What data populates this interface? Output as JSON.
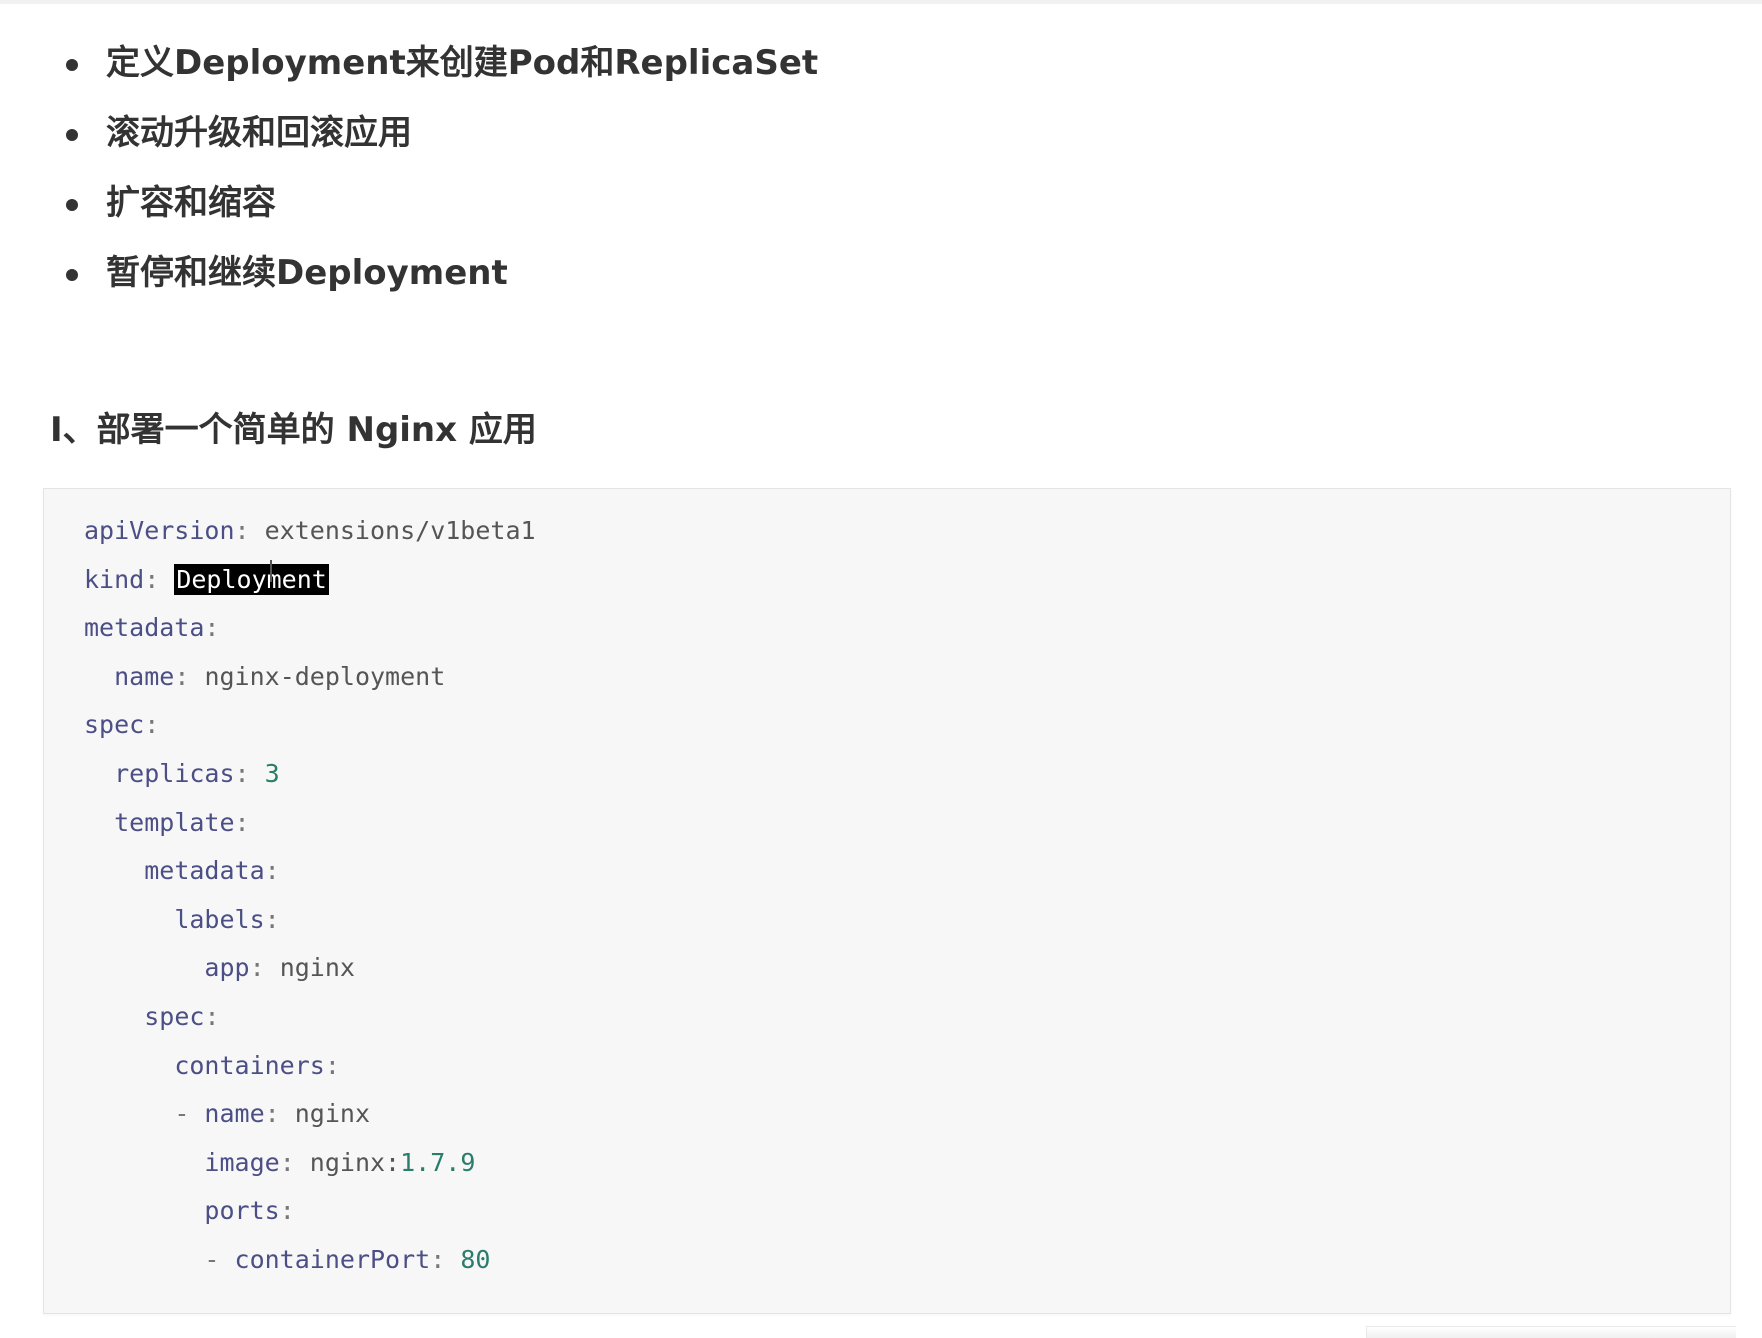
{
  "bullets": [
    "定义Deployment来创建Pod和ReplicaSet",
    "滚动升级和回滚应用",
    "扩容和缩容",
    "暂停和继续Deployment"
  ],
  "heading": "I、部署一个简单的 Nginx 应用",
  "code": {
    "apiVersion_key": "apiVersion",
    "apiVersion_value": "extensions/v1beta1",
    "kind_key": "kind",
    "kind_value": "Deployment",
    "metadata_key": "metadata",
    "name_key": "name",
    "name_value": "nginx-deployment",
    "spec_key": "spec",
    "replicas_key": "replicas",
    "replicas_value": "3",
    "template_key": "template",
    "tmpl_metadata_key": "metadata",
    "labels_key": "labels",
    "app_key": "app",
    "app_value": "nginx",
    "tmpl_spec_key": "spec",
    "containers_key": "containers",
    "container_name_key": "name",
    "container_name_value": "nginx",
    "image_key": "image",
    "image_value_prefix": "nginx:",
    "image_value_version": "1.7.9",
    "ports_key": "ports",
    "containerPort_key": "containerPort",
    "containerPort_value": "80"
  },
  "colors": {
    "text": "#333333",
    "code_background": "#f7f7f7",
    "code_key": "#4c4f85",
    "code_number": "#2a7d6a",
    "selection_background": "#000000"
  }
}
